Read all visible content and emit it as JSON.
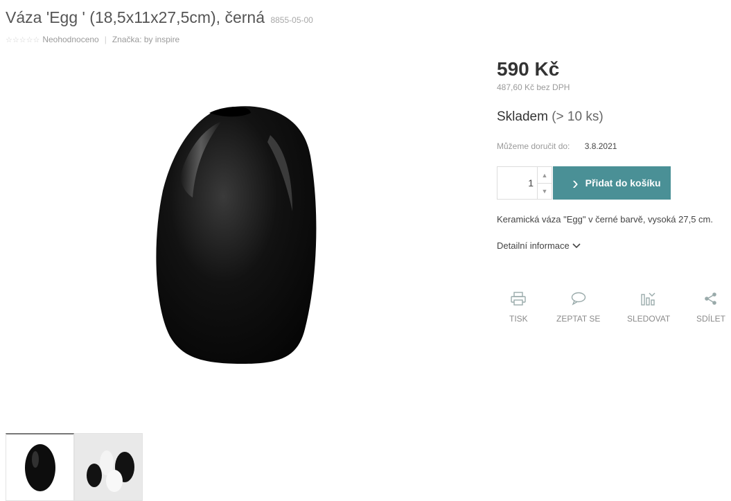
{
  "product": {
    "title": "Váza 'Egg ' (18,5x11x27,5cm), černá",
    "code": "8855-05-00",
    "rating_text": "Neohodnoceno",
    "brand_label": "Značka:",
    "brand": "by inspire",
    "stars_glyph": "☆☆☆☆☆",
    "sep_glyph": "|"
  },
  "pricing": {
    "price": "590 Kč",
    "price_without_vat": "487,60 Kč bez DPH"
  },
  "availability": {
    "status": "Skladem",
    "count": "(> 10 ks)",
    "delivery_label": "Můžeme doručit do:",
    "delivery_date": "3.8.2021"
  },
  "cart": {
    "quantity": "1",
    "add_label": "Přidat do košíku",
    "chevron_glyph": "›",
    "up_glyph": "▲",
    "down_glyph": "▼"
  },
  "description": {
    "short": "Keramická váza \"Egg\" v černé barvě, vysoká 27,5 cm.",
    "detail_link": "Detailní informace"
  },
  "actions": [
    {
      "label": "TISK",
      "icon": "print-icon"
    },
    {
      "label": "ZEPTAT SE",
      "icon": "chat-icon"
    },
    {
      "label": "SLEDOVAT",
      "icon": "chart-watch-icon"
    },
    {
      "label": "SDÍLET",
      "icon": "share-icon"
    }
  ],
  "colors": {
    "accent": "#4a9096",
    "vase": "#0d0d0d"
  }
}
